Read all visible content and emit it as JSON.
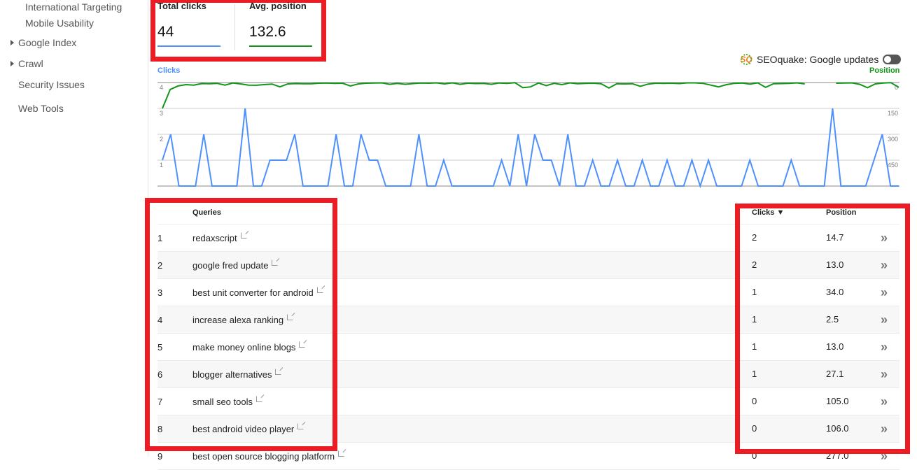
{
  "sidebar": {
    "items": [
      {
        "label": "International Targeting",
        "level": "sub",
        "expandable": false
      },
      {
        "label": "Mobile Usability",
        "level": "sub",
        "expandable": false
      },
      {
        "label": "Google Index",
        "level": "top",
        "expandable": true
      },
      {
        "label": "Crawl",
        "level": "top",
        "expandable": true
      },
      {
        "label": "Security Issues",
        "level": "top",
        "expandable": false
      },
      {
        "label": "Web Tools",
        "level": "top",
        "expandable": false
      }
    ]
  },
  "metrics": {
    "clicks": {
      "label": "Total clicks",
      "value": "44",
      "color": "#4d90fe"
    },
    "position": {
      "label": "Avg. position",
      "value": "132.6",
      "color": "#109618"
    }
  },
  "seoquake": {
    "logo": "SQ",
    "label": "SEOquake: Google updates",
    "toggle_on": false
  },
  "chart_data": {
    "type": "line",
    "left_axis": {
      "title": "Clicks",
      "color": "#4d90fe",
      "ticks": [
        "4",
        "3",
        "2",
        "1"
      ],
      "range": [
        0,
        4
      ]
    },
    "right_axis": {
      "title": "Position",
      "color": "#109618",
      "ticks": [
        "0",
        "150",
        "300",
        "450"
      ],
      "range": [
        0,
        600
      ],
      "inverted": true
    },
    "grid": true,
    "series": [
      {
        "name": "Clicks",
        "axis": "left",
        "color": "#4d90fe",
        "values": [
          1,
          2,
          0,
          0,
          0,
          2,
          0,
          0,
          0,
          0,
          3,
          0,
          0,
          1,
          1,
          1,
          2,
          0,
          0,
          0,
          0,
          2,
          0,
          0,
          2,
          1,
          1,
          0,
          0,
          0,
          0,
          2,
          0,
          0,
          1,
          0,
          0,
          0,
          0,
          0,
          0,
          1,
          0,
          2,
          0,
          2,
          1,
          1,
          0,
          2,
          0,
          0,
          1,
          0,
          0,
          1,
          0,
          0,
          1,
          0,
          0,
          1,
          0,
          0,
          1,
          0,
          1,
          0,
          0,
          0,
          0,
          1,
          0,
          0,
          0,
          0,
          1,
          0,
          0,
          0,
          0,
          3,
          0,
          0,
          0,
          0,
          1,
          2,
          0,
          0
        ]
      },
      {
        "name": "Position",
        "axis": "right",
        "color": "#109618",
        "values": [
          150,
          40,
          20,
          12,
          15,
          6,
          7,
          5,
          15,
          3,
          8,
          15,
          16,
          12,
          9,
          25,
          8,
          6,
          7,
          7,
          4,
          3,
          5,
          4,
          20,
          8,
          4,
          3,
          2,
          10,
          5,
          10,
          6,
          3,
          4,
          2,
          8,
          2,
          10,
          4,
          6,
          5,
          10,
          3,
          5,
          1,
          30,
          25,
          3,
          18,
          5,
          12,
          2,
          7,
          5,
          4,
          7,
          32,
          7,
          8,
          7,
          22,
          9,
          4,
          5,
          4,
          6,
          2,
          2,
          5,
          15,
          25,
          12,
          5,
          3,
          9,
          2,
          28,
          7,
          6,
          5,
          2,
          8,
          null,
          7,
          null,
          4,
          3,
          2,
          10,
          30,
          8,
          3,
          1,
          28
        ]
      }
    ]
  },
  "table": {
    "headers": {
      "queries": "Queries",
      "clicks": "Clicks ▼",
      "position": "Position"
    },
    "more_icon": "»",
    "rows": [
      {
        "num": "1",
        "query": "redaxscript",
        "clicks": "2",
        "position": "14.7"
      },
      {
        "num": "2",
        "query": "google fred update",
        "clicks": "2",
        "position": "13.0"
      },
      {
        "num": "3",
        "query": "best unit converter for android",
        "clicks": "1",
        "position": "34.0"
      },
      {
        "num": "4",
        "query": "increase alexa ranking",
        "clicks": "1",
        "position": "2.5"
      },
      {
        "num": "5",
        "query": "make money online blogs",
        "clicks": "1",
        "position": "13.0"
      },
      {
        "num": "6",
        "query": "blogger alternatives",
        "clicks": "1",
        "position": "27.1"
      },
      {
        "num": "7",
        "query": "small seo tools",
        "clicks": "0",
        "position": "105.0"
      },
      {
        "num": "8",
        "query": "best android video player",
        "clicks": "0",
        "position": "106.0"
      },
      {
        "num": "9",
        "query": "best open source blogging platform",
        "clicks": "0",
        "position": "277.0"
      }
    ]
  }
}
